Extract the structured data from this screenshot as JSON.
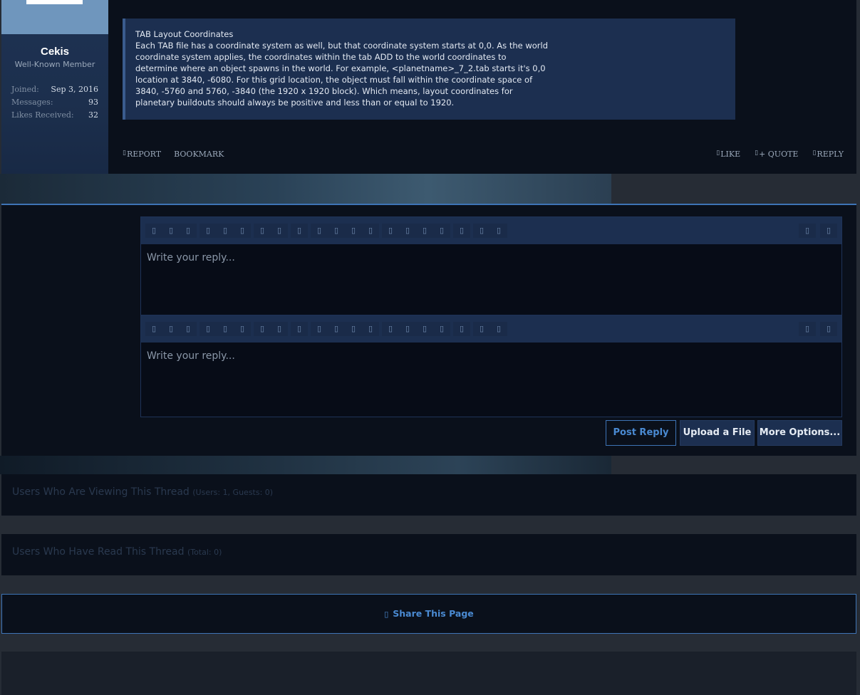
{
  "post": {
    "user": {
      "name": "Cekis",
      "title": "Well-Known Member",
      "stats": [
        {
          "label": "Joined:",
          "value": "Sep 3, 2016"
        },
        {
          "label": "Messages:",
          "value": "93"
        },
        {
          "label": "Likes Received:",
          "value": "32"
        }
      ]
    },
    "quote": {
      "title": "TAB Layout Coordinates",
      "body": "Each TAB file has a coordinate system as well, but that coordinate system starts at 0,0. As the world coordinate system applies, the coordinates within the tab ADD to the world coordinates to determine where an object spawns in the world. For example, <planetname>_7_2.tab starts it's 0,0 location at 3840, -6080. For this grid location, the object must fall within the coordinate space of 3840, -5760 and 5760, -3840 (the 1920 x 1920 block). Which means, layout coordinates for planetary buildouts should always be positive and less than or equal to 1920."
    },
    "actions": {
      "report": "REPORT",
      "bookmark": "BOOKMARK",
      "like": "LIKE",
      "quote": "+ QUOTE",
      "reply": "REPLY",
      "glyph": "▯"
    }
  },
  "editor": {
    "placeholder": "Write your reply...",
    "toolbar_glyph": "▯"
  },
  "buttons": {
    "post_reply": "Post Reply",
    "upload": "Upload a File",
    "more": "More Options..."
  },
  "viewing": {
    "title": "Users Who Are Viewing This Thread",
    "sub": "(Users: 1, Guests: 0)"
  },
  "read": {
    "title": "Users Who Have Read This Thread",
    "sub": "(Total: 0)"
  },
  "share": {
    "label": "Share This Page",
    "glyph": "▯"
  },
  "colors": {
    "accent": "#3e74b6",
    "panel": "#0a101b",
    "header": "#1c2f50"
  }
}
